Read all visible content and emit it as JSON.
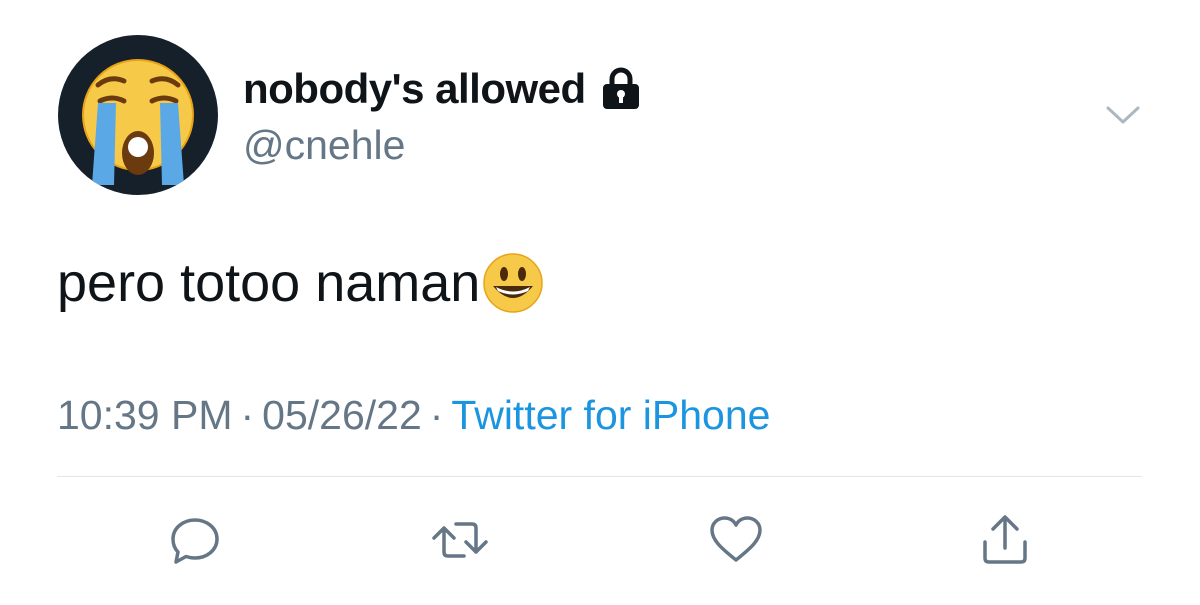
{
  "tweet": {
    "display_name": "nobody's allowed",
    "handle": "@cnehle",
    "text": "pero totoo naman",
    "time": "10:39 PM",
    "date": "05/26/22",
    "separator": "·",
    "source": "Twitter for iPhone"
  },
  "icons": {
    "avatar": "loudly-crying-face-emoji",
    "lock": "lock-icon",
    "menu": "chevron-down-icon",
    "text_emoji": "smiling-face-big-eyes-emoji",
    "reply": "reply-icon",
    "retweet": "retweet-icon",
    "like": "heart-icon",
    "share": "share-icon"
  },
  "colors": {
    "text_primary": "#0f1419",
    "text_secondary": "#657786",
    "link": "#1b95e0",
    "divider": "#e1e8ed",
    "icon_gray": "#657786",
    "avatar_bg": "#15202b"
  }
}
